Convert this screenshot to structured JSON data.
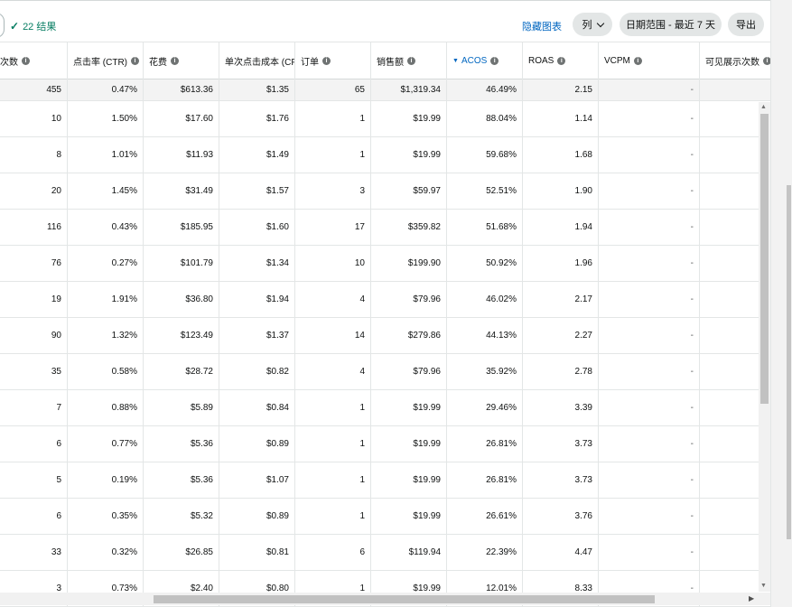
{
  "toolbar": {
    "results_text": "22 结果",
    "hide_chart_label": "隐藏图表",
    "columns_label": "列",
    "date_range_label": "日期范围 - 最近 7 天",
    "export_label": "导出"
  },
  "table": {
    "columns": [
      {
        "key": "clicks",
        "label": "点击次数",
        "info": true
      },
      {
        "key": "ctr",
        "label": "点击率 (CTR)",
        "info": true
      },
      {
        "key": "spend",
        "label": "花费",
        "info": true
      },
      {
        "key": "cpc",
        "label": "单次点击成本 (CPC)",
        "info": false
      },
      {
        "key": "orders",
        "label": "订单",
        "info": true
      },
      {
        "key": "sales",
        "label": "销售额",
        "info": true
      },
      {
        "key": "acos",
        "label": "ACOS",
        "info": true,
        "sorted": "desc"
      },
      {
        "key": "roas",
        "label": "ROAS",
        "info": true
      },
      {
        "key": "vcpm",
        "label": "VCPM",
        "info": true
      },
      {
        "key": "viewable",
        "label": "可见展示次数",
        "info": true
      }
    ],
    "totals": [
      "455",
      "0.47%",
      "$613.36",
      "$1.35",
      "65",
      "$1,319.34",
      "46.49%",
      "2.15",
      "-",
      ""
    ],
    "rows": [
      [
        "10",
        "1.50%",
        "$17.60",
        "$1.76",
        "1",
        "$19.99",
        "88.04%",
        "1.14",
        "-",
        ""
      ],
      [
        "8",
        "1.01%",
        "$11.93",
        "$1.49",
        "1",
        "$19.99",
        "59.68%",
        "1.68",
        "-",
        ""
      ],
      [
        "20",
        "1.45%",
        "$31.49",
        "$1.57",
        "3",
        "$59.97",
        "52.51%",
        "1.90",
        "-",
        ""
      ],
      [
        "116",
        "0.43%",
        "$185.95",
        "$1.60",
        "17",
        "$359.82",
        "51.68%",
        "1.94",
        "-",
        ""
      ],
      [
        "76",
        "0.27%",
        "$101.79",
        "$1.34",
        "10",
        "$199.90",
        "50.92%",
        "1.96",
        "-",
        ""
      ],
      [
        "19",
        "1.91%",
        "$36.80",
        "$1.94",
        "4",
        "$79.96",
        "46.02%",
        "2.17",
        "-",
        ""
      ],
      [
        "90",
        "1.32%",
        "$123.49",
        "$1.37",
        "14",
        "$279.86",
        "44.13%",
        "2.27",
        "-",
        ""
      ],
      [
        "35",
        "0.58%",
        "$28.72",
        "$0.82",
        "4",
        "$79.96",
        "35.92%",
        "2.78",
        "-",
        ""
      ],
      [
        "7",
        "0.88%",
        "$5.89",
        "$0.84",
        "1",
        "$19.99",
        "29.46%",
        "3.39",
        "-",
        ""
      ],
      [
        "6",
        "0.77%",
        "$5.36",
        "$0.89",
        "1",
        "$19.99",
        "26.81%",
        "3.73",
        "-",
        ""
      ],
      [
        "5",
        "0.19%",
        "$5.36",
        "$1.07",
        "1",
        "$19.99",
        "26.81%",
        "3.73",
        "-",
        ""
      ],
      [
        "6",
        "0.35%",
        "$5.32",
        "$0.89",
        "1",
        "$19.99",
        "26.61%",
        "3.76",
        "-",
        ""
      ],
      [
        "33",
        "0.32%",
        "$26.85",
        "$0.81",
        "6",
        "$119.94",
        "22.39%",
        "4.47",
        "-",
        ""
      ],
      [
        "3",
        "0.73%",
        "$2.40",
        "$0.80",
        "1",
        "$19.99",
        "12.01%",
        "8.33",
        "-",
        ""
      ]
    ]
  },
  "colors": {
    "link": "#0066c0",
    "success": "#067d62",
    "button_bg": "#e3e6e6",
    "total_row_bg": "#f3f3f3"
  },
  "icons": {
    "results": "check-icon",
    "info": "info-icon",
    "sort": "sort-desc-icon",
    "dropdown": "chevron-down-icon"
  }
}
